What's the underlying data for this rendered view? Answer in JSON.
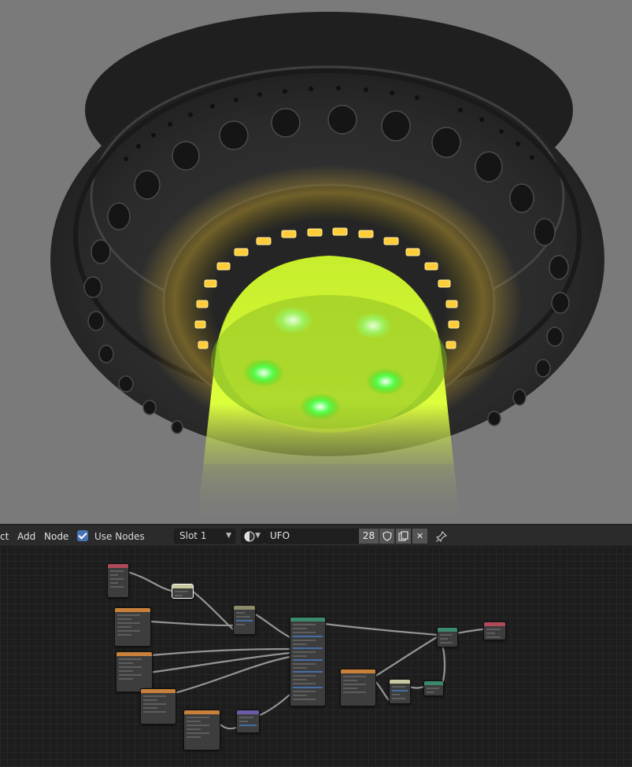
{
  "header": {
    "menus": [
      "ct",
      "Add",
      "Node"
    ],
    "use_nodes_label": "Use Nodes",
    "use_nodes_checked": true,
    "slot_label": "Slot 1",
    "material_name": "UFO",
    "user_count": "28",
    "icons": {
      "material_browse": "material-sphere-icon",
      "fake_user": "shield-icon",
      "duplicate": "duplicate-icon",
      "unlink": "close-icon",
      "pin": "pin-icon"
    }
  },
  "colors": {
    "viewport_bg": "#7a7a7a",
    "beam": "#d8ff3a",
    "glow_green": "#4dff4d",
    "ring_lights": "#ffd23a",
    "accent": "#4772b3"
  },
  "node_editor": {
    "nodes": [
      {
        "id": "n1",
        "type": "texture-coordinate",
        "header_color": "#b04a5a"
      },
      {
        "id": "n2",
        "type": "mapping",
        "header_color": "#c9c9a0"
      },
      {
        "id": "n3",
        "type": "image-texture",
        "header_color": "#c8803a"
      },
      {
        "id": "n4",
        "type": "mix",
        "header_color": "#8c8c6a"
      },
      {
        "id": "n5",
        "type": "principled-bsdf",
        "header_color": "#3c8a6c"
      },
      {
        "id": "n6",
        "type": "image-texture",
        "header_color": "#c8803a"
      },
      {
        "id": "n7",
        "type": "image-texture",
        "header_color": "#c8803a"
      },
      {
        "id": "n8",
        "type": "image-texture",
        "header_color": "#c8803a"
      },
      {
        "id": "n9",
        "type": "normal-map",
        "header_color": "#6a5aa8"
      },
      {
        "id": "n10",
        "type": "image-texture",
        "header_color": "#c8803a"
      },
      {
        "id": "n11",
        "type": "color-ramp",
        "header_color": "#c9c9a0"
      },
      {
        "id": "n12",
        "type": "emission",
        "header_color": "#3c8a6c"
      },
      {
        "id": "n13",
        "type": "mix-shader",
        "header_color": "#3c8a6c"
      },
      {
        "id": "n14",
        "type": "material-output",
        "header_color": "#b04a5a"
      }
    ]
  }
}
